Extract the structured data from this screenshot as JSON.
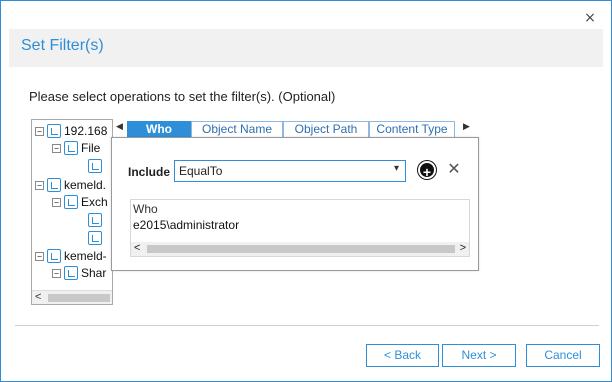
{
  "window": {
    "close_glyph": "×"
  },
  "header": {
    "title": "Set Filter(s)"
  },
  "instruction": "Please select operations to set the filter(s). (Optional)",
  "tree": {
    "nodes": [
      {
        "label": "192.168",
        "level": 0,
        "expander": "−"
      },
      {
        "label": "File",
        "level": 1,
        "expander": "−"
      },
      {
        "label": "",
        "level": 2,
        "expander": ""
      },
      {
        "label": "kemeld.",
        "level": 0,
        "expander": "−"
      },
      {
        "label": "Exch",
        "level": 1,
        "expander": "−"
      },
      {
        "label": "",
        "level": 2,
        "expander": ""
      },
      {
        "label": "",
        "level": 2,
        "expander": ""
      },
      {
        "label": "kemeld-",
        "level": 0,
        "expander": "−"
      },
      {
        "label": "Shar",
        "level": 1,
        "expander": "−"
      }
    ],
    "scroll_left_glyph": "<"
  },
  "filter": {
    "tabs": [
      {
        "label": "Who",
        "active": true
      },
      {
        "label": "Object Name",
        "active": false
      },
      {
        "label": "Object Path",
        "active": false
      },
      {
        "label": "Content Type",
        "active": false
      }
    ],
    "include_label": "Include",
    "include_value": "EqualTo",
    "caret": "▾",
    "add_glyph": "+",
    "remove_glyph": "✕",
    "grid": {
      "column": "Who",
      "rows": [
        "e2015\\administrator"
      ]
    },
    "scroll_left_glyph": "<",
    "scroll_right_glyph": ">"
  },
  "buttons": {
    "back": "< Back",
    "next": "Next >",
    "cancel": "Cancel"
  },
  "colors": {
    "accent": "#2e8fd8"
  }
}
